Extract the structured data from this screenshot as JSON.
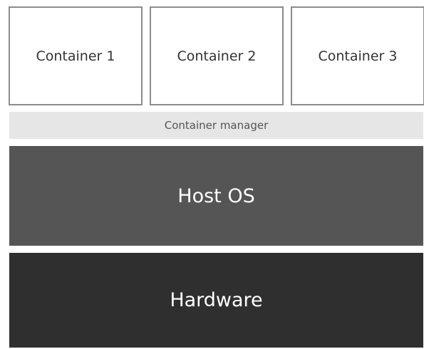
{
  "containers": [
    {
      "label": "Container 1"
    },
    {
      "label": "Container 2"
    },
    {
      "label": "Container 3"
    }
  ],
  "manager": {
    "label": "Container manager",
    "color": "#e6e6e6"
  },
  "host_os": {
    "label": "Host OS",
    "color": "#555555"
  },
  "hardware": {
    "label": "Hardware",
    "color": "#2f2f2f"
  }
}
